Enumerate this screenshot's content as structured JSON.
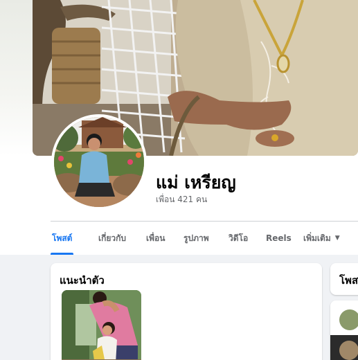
{
  "profile": {
    "name": "แม่ เหรียญ",
    "friends": "เพื่อน 421 คน"
  },
  "tabs": [
    {
      "label": "โพสต์",
      "active": true
    },
    {
      "label": "เกี่ยวกับ",
      "active": false
    },
    {
      "label": "เพื่อน",
      "active": false
    },
    {
      "label": "รูปภาพ",
      "active": false
    },
    {
      "label": "วิดีโอ",
      "active": false
    },
    {
      "label": "Reels",
      "active": false
    },
    {
      "label": "เพิ่มเติม",
      "active": false,
      "icon": "caret-down-icon"
    }
  ],
  "intro": {
    "title": "แนะนำตัว"
  },
  "posts": {
    "title": "โพสต์"
  },
  "colors": {
    "accent": "#1877f2",
    "muted_text": "#65676b",
    "background": "#f0f2f5"
  }
}
